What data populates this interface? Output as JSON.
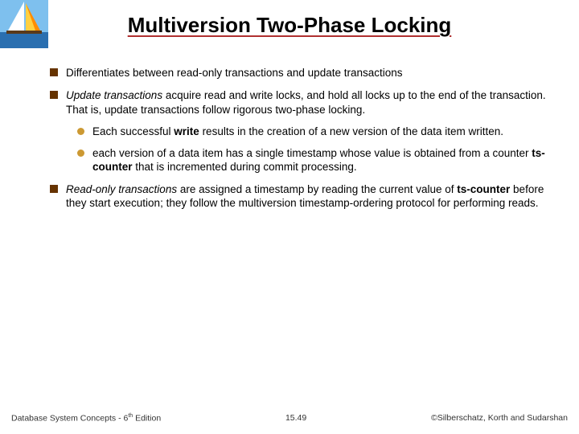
{
  "title": "Multiversion Two-Phase Locking",
  "bullets": {
    "b1": "Differentiates between read-only transactions and update transactions",
    "b2_pre": "Update transactions",
    "b2_post": " acquire read and write locks, and hold all locks up to the end of the transaction. That is, update transactions follow rigorous two-phase locking.",
    "s1_pre": "Each successful ",
    "s1_bold": "write",
    "s1_post": " results in the creation of a new version of the data item written.",
    "s2_pre": "each version of a data item has a single timestamp whose value is obtained from a counter ",
    "s2_bold": "ts-counter",
    "s2_post": " that is incremented during commit processing.",
    "b3_pre": "Read-only transactions",
    "b3_mid": " are assigned a timestamp by reading the current value of  ",
    "b3_bold": "ts-counter",
    "b3_post": " before they start execution; they follow the multiversion timestamp-ordering protocol for performing reads."
  },
  "footer": {
    "left_a": "Database System Concepts - 6",
    "left_b": " Edition",
    "left_sup": "th",
    "center": "15.49",
    "right": "©Silberschatz, Korth and Sudarshan"
  }
}
